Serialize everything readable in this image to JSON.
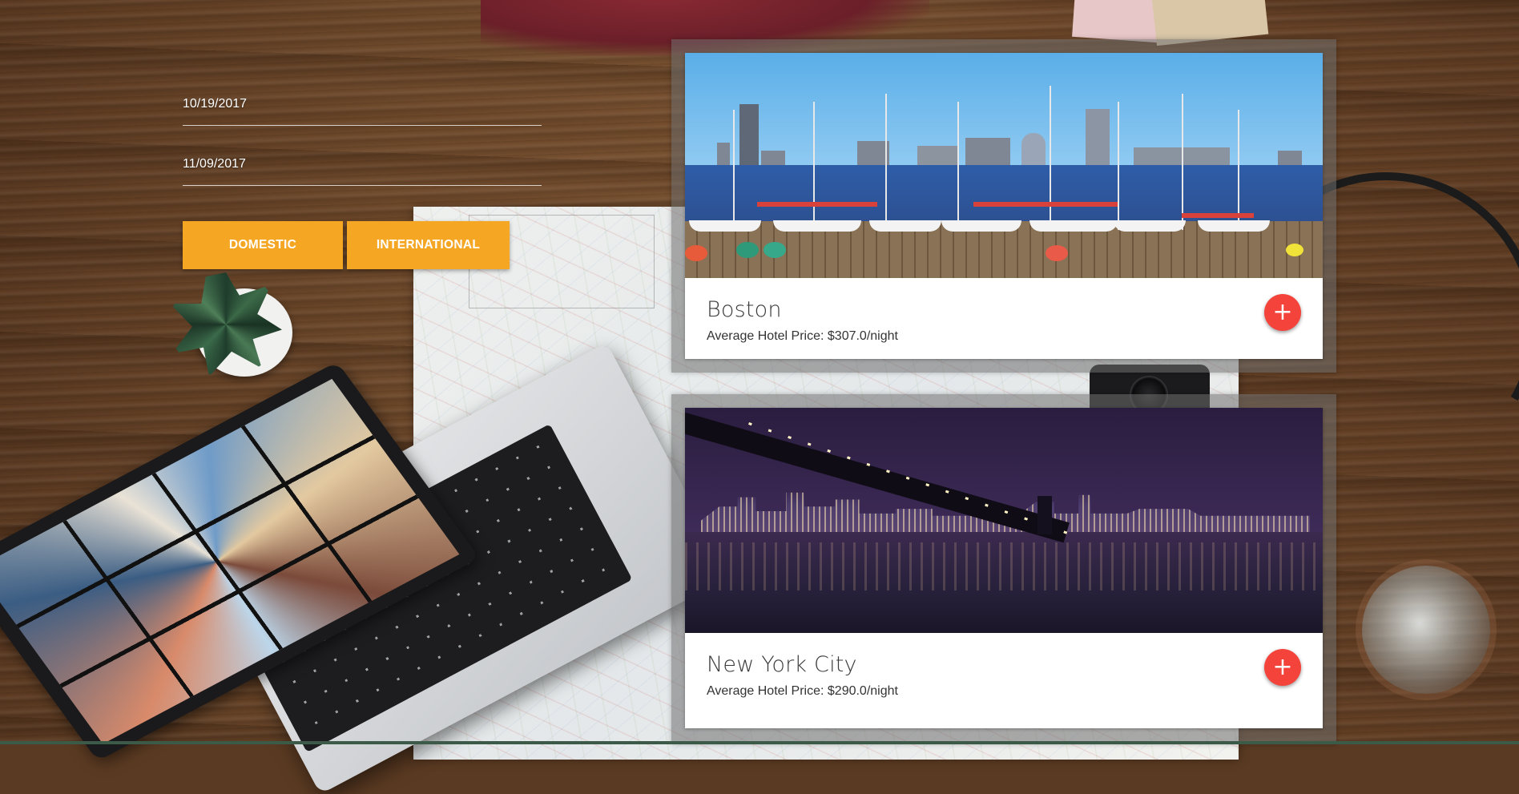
{
  "search_form": {
    "start_date": "10/19/2017",
    "end_date": "11/09/2017",
    "domestic_label": "DOMESTIC",
    "international_label": "INTERNATIONAL"
  },
  "destinations": [
    {
      "city": "Boston",
      "price_text": "Average Hotel Price: $307.0/night",
      "add_icon": "plus-icon"
    },
    {
      "city": "New York City",
      "price_text": "Average Hotel Price: $290.0/night",
      "add_icon": "plus-icon"
    }
  ],
  "colors": {
    "button_accent": "#f5a623",
    "fab_red": "#f4433b",
    "card_bg": "#ffffff"
  },
  "fab_symbol": "+"
}
